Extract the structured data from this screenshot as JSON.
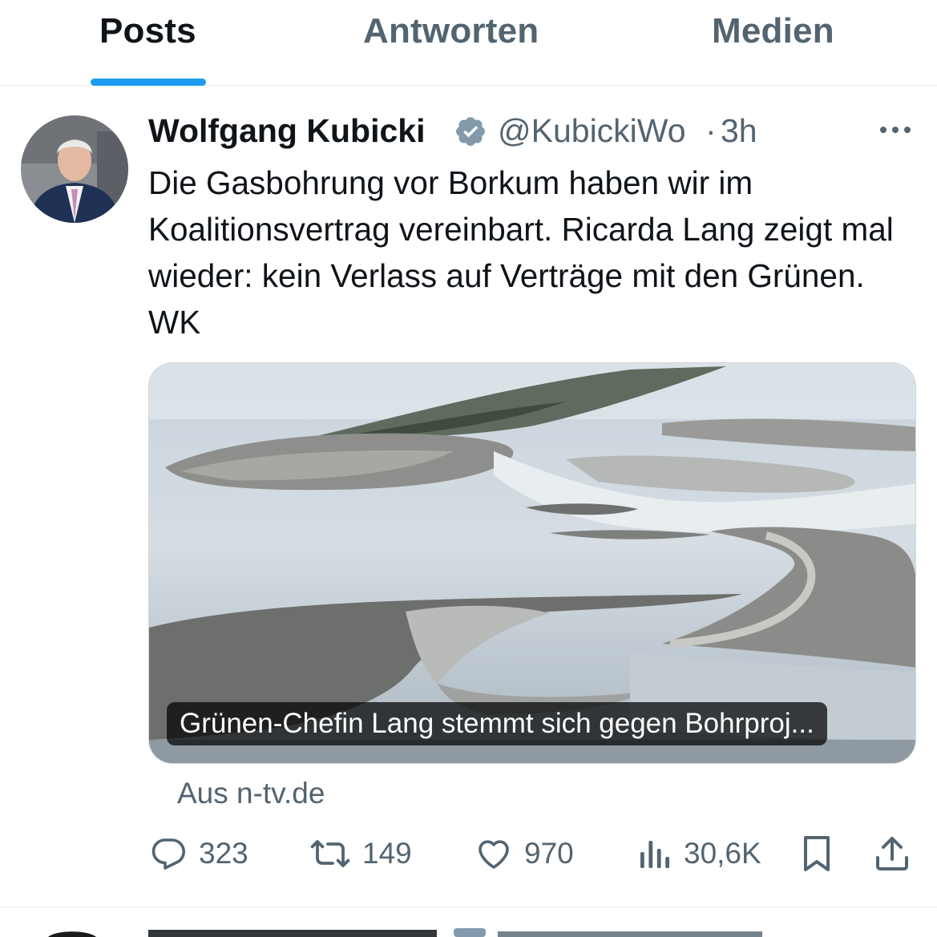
{
  "tabs": {
    "posts": "Posts",
    "replies": "Antworten",
    "media": "Medien",
    "active": "posts"
  },
  "tweet": {
    "author_name": "Wolfgang Kubicki",
    "handle": "@KubickiWo",
    "separator": "·",
    "time": "3h",
    "text": "Die Gasbohrung vor Borkum haben wir im Koalitionsvertrag vereinbart. Ricarda Lang zeigt mal wieder: kein Verlass auf Verträge mit den Grünen. WK",
    "card": {
      "title": "Grünen-Chefin Lang stemmt sich gegen Bohrproj...",
      "source": "Aus n-tv.de"
    },
    "actions": {
      "replies": "323",
      "reposts": "149",
      "likes": "970",
      "views": "30,6K"
    }
  },
  "icons": {
    "verified": "verified-badge-icon",
    "more": "more-dots-icon",
    "reply": "reply-bubble-icon",
    "retweet": "retweet-icon",
    "like": "heart-icon",
    "views": "bar-chart-icon",
    "bookmark": "bookmark-icon",
    "share": "share-upload-icon"
  },
  "colors": {
    "accent": "#1d9bf0",
    "text": "#0f1419",
    "secondary": "#536471",
    "border": "#e6ebee"
  }
}
